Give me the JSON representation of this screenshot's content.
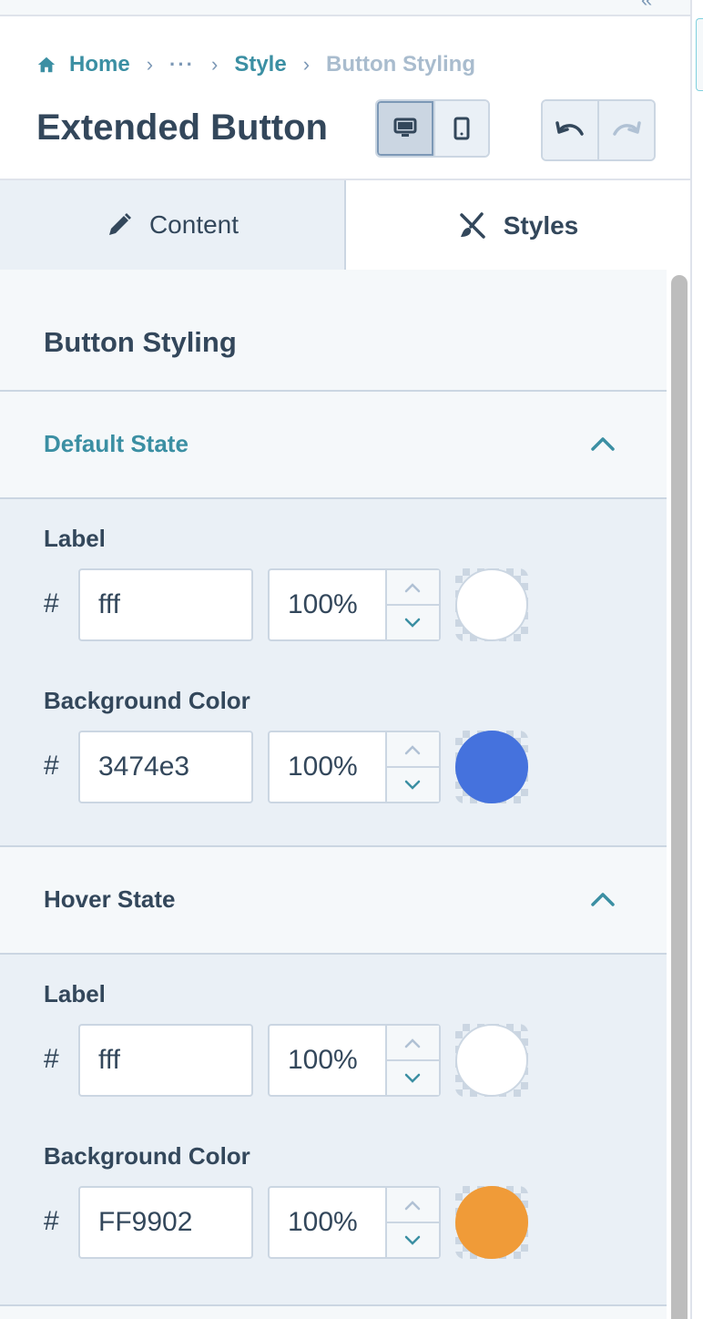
{
  "breadcrumb": {
    "home": "Home",
    "ellipsis": "···",
    "style": "Style",
    "current": "Button Styling"
  },
  "header": {
    "title": "Extended Button"
  },
  "tabs": {
    "content": "Content",
    "styles": "Styles"
  },
  "panel": {
    "section_title": "Button Styling",
    "default_state": {
      "title": "Default State",
      "label": {
        "label": "Label",
        "hash": "#",
        "hex": "fff",
        "opacity": "100%",
        "color": "#ffffff"
      },
      "background": {
        "label": "Background Color",
        "hash": "#",
        "hex": "3474e3",
        "opacity": "100%",
        "color": "#4572dd"
      }
    },
    "hover_state": {
      "title": "Hover State",
      "label": {
        "label": "Label",
        "hash": "#",
        "hex": "fff",
        "opacity": "100%",
        "color": "#ffffff"
      },
      "background": {
        "label": "Background Color",
        "hash": "#",
        "hex": "FF9902",
        "opacity": "100%",
        "color": "#f09b38"
      }
    }
  },
  "colors": {
    "accent": "#3b8fa3",
    "text": "#33475b",
    "muted": "#a9bcce",
    "border": "#cbd6e2"
  }
}
